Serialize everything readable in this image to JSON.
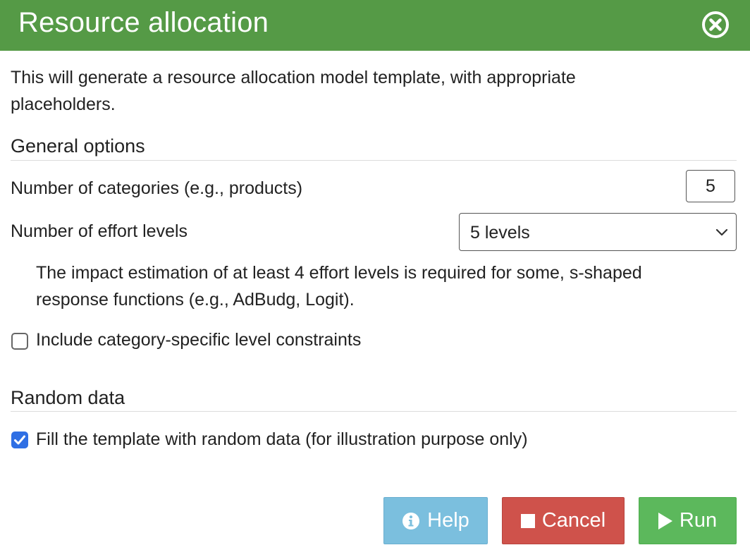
{
  "dialog": {
    "title": "Resource allocation",
    "description_line1": "This will generate a resource allocation model template, with appropriate",
    "description_line2": "placeholders."
  },
  "general_options": {
    "heading": "General options",
    "categories_label": "Number of categories (e.g., products)",
    "categories_value": "5",
    "effort_label": "Number of effort levels",
    "effort_selected": "5 levels",
    "note_line1": "The impact estimation of at least 4 effort levels is required for some, s-shaped",
    "note_line2": "response functions (e.g., AdBudg, Logit).",
    "constraints_label": "Include category-specific level constraints",
    "constraints_checked": false
  },
  "random_data": {
    "heading": "Random data",
    "fill_label": "Fill the template with random data (for illustration purpose only)",
    "fill_checked": true
  },
  "buttons": {
    "help": "Help",
    "cancel": "Cancel",
    "run": "Run"
  },
  "colors": {
    "header": "#559a46",
    "help": "#7bbfde",
    "cancel": "#cf524b",
    "run": "#5cb85c",
    "checkbox": "#2f6fe4"
  },
  "icons": {
    "close": "close-circle-icon",
    "help": "info-icon",
    "cancel": "stop-icon",
    "run": "play-icon",
    "select": "chevron-down-icon"
  }
}
